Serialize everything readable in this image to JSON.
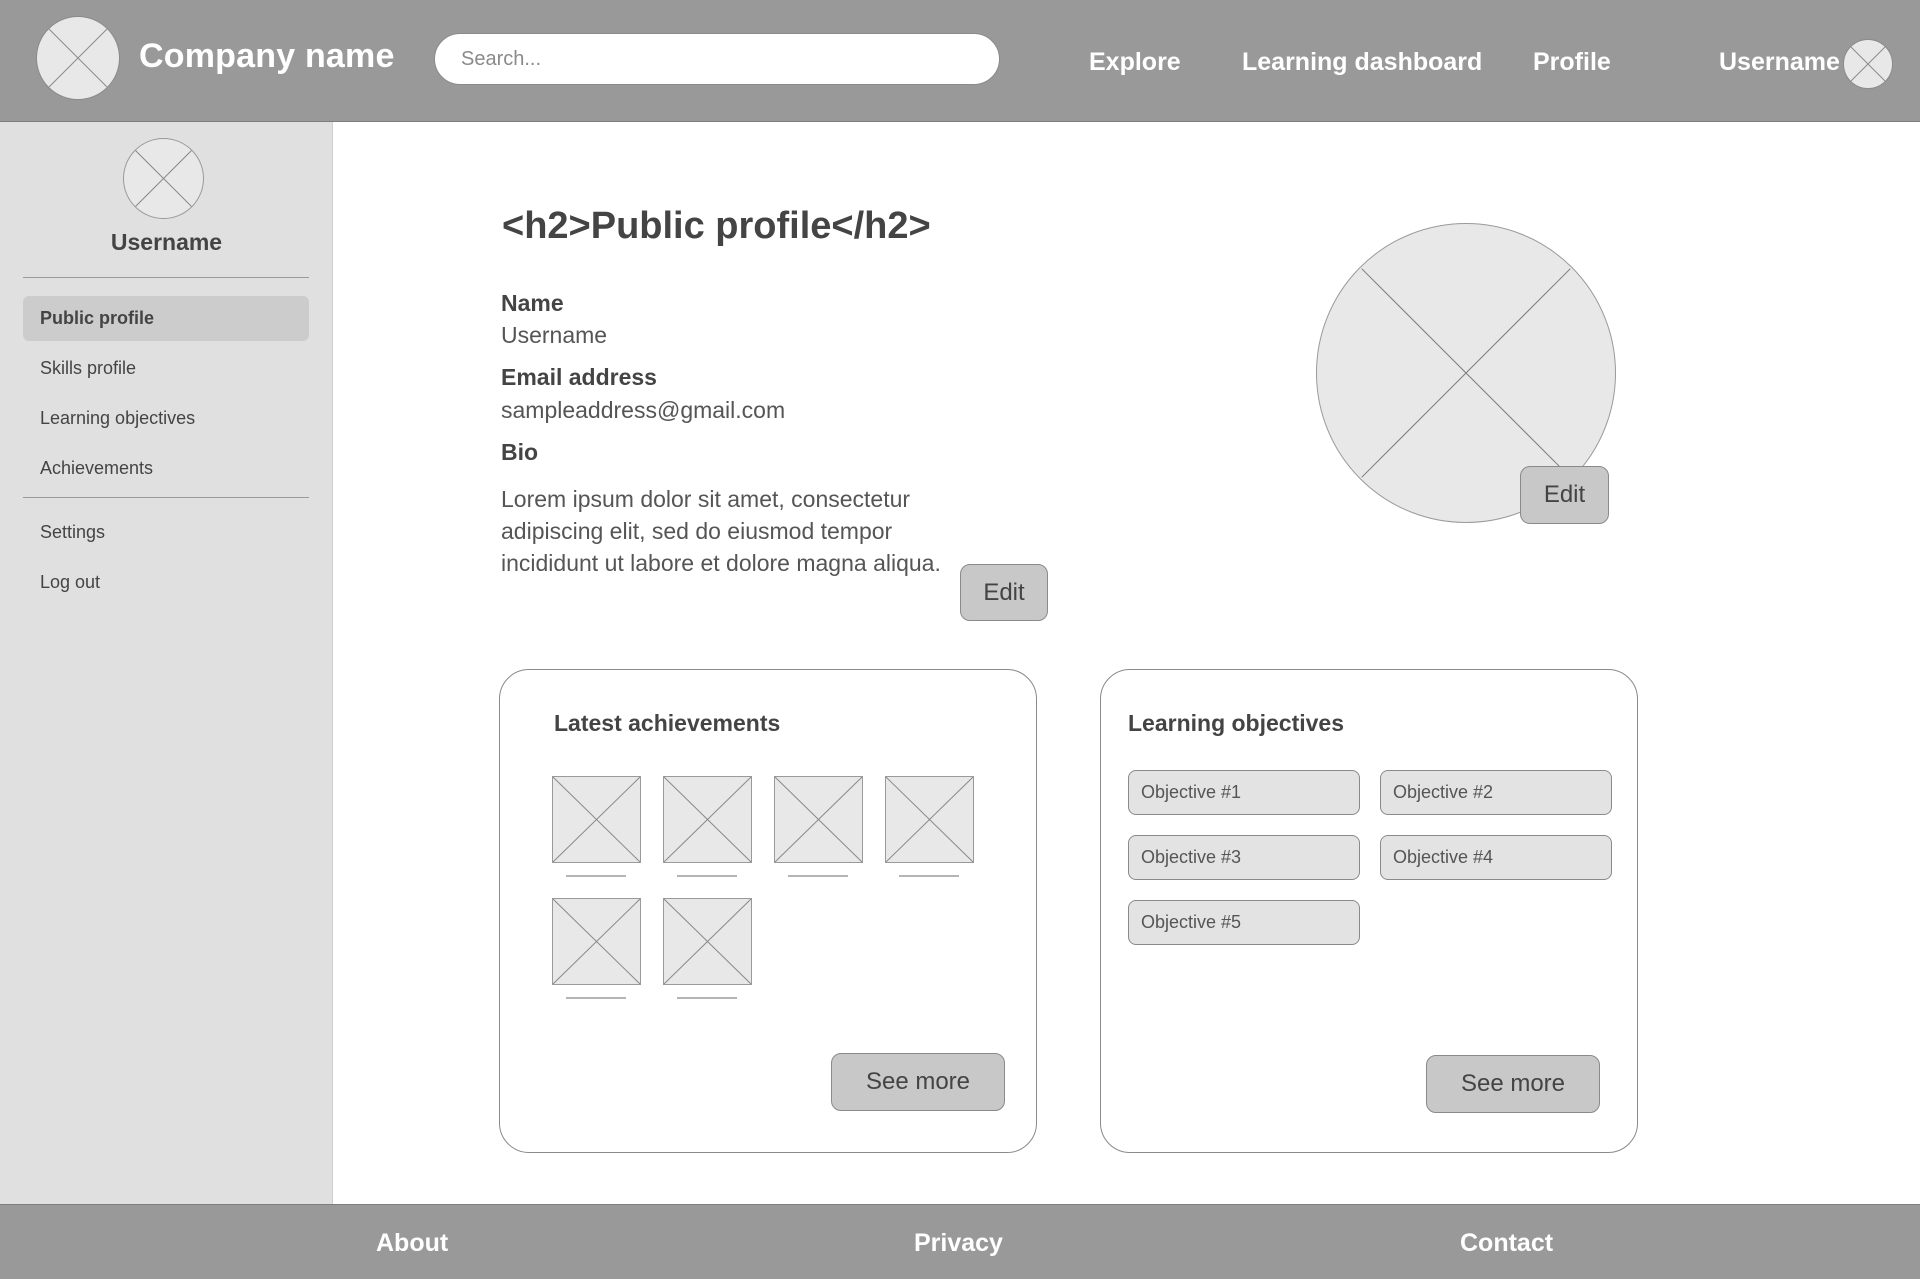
{
  "header": {
    "company_name": "Company name",
    "search_placeholder": "Search...",
    "nav": [
      "Explore",
      "Learning dashboard",
      "Profile"
    ],
    "username": "Username"
  },
  "sidebar": {
    "username": "Username",
    "items": [
      "Public profile",
      "Skills profile",
      "Learning objectives",
      "Achievements"
    ],
    "secondary_items": [
      "Settings",
      "Log out"
    ],
    "active_item": "Public profile"
  },
  "main": {
    "heading": "<h2>Public profile</h2>",
    "name_label": "Name",
    "name_value": "Username",
    "email_label": "Email address",
    "email_value": "sampleaddress@gmail.com",
    "bio_label": "Bio",
    "bio_text": "Lorem ipsum dolor sit amet, consectetur adipiscing elit, sed do eiusmod tempor incididunt ut labore et dolore magna aliqua.",
    "bio_edit": "Edit",
    "photo_edit": "Edit"
  },
  "achievements": {
    "title": "Latest achievements",
    "see_more": "See more"
  },
  "objectives": {
    "title": "Learning objectives",
    "items": [
      "Objective #1",
      "Objective #2",
      "Objective #3",
      "Objective #4",
      "Objective #5"
    ],
    "see_more": "See more"
  },
  "footer": {
    "links": [
      "About",
      "Privacy",
      "Contact"
    ]
  },
  "colors": {
    "header_bg": "#999999",
    "sidebar_bg": "#e0e0e0",
    "active_item_bg": "#cccccc",
    "placeholder_fill": "#e8e8e8",
    "button_bg": "#c8c8c8"
  }
}
